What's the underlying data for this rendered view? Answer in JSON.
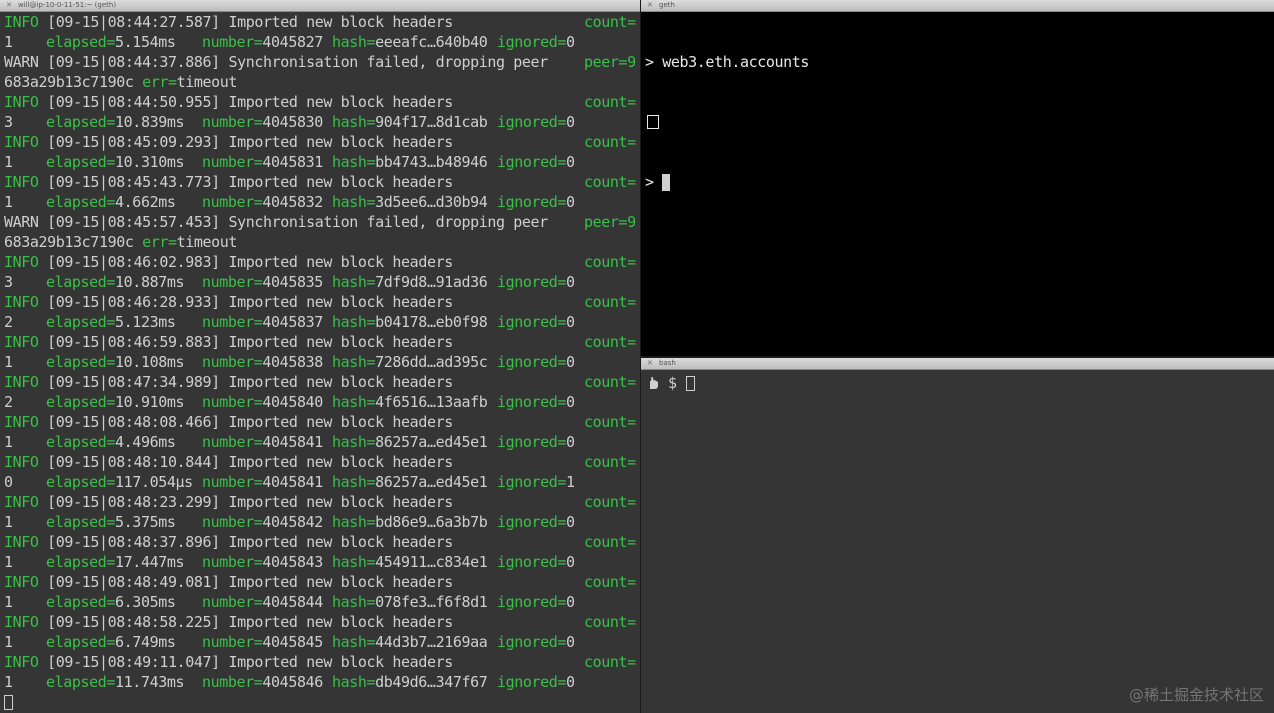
{
  "left_pane": {
    "title": "will@ip-10-0-11-51:~ (geth)",
    "entries": [
      {
        "level": "INFO",
        "ts": "[09-15|08:44:27.587]",
        "msg": "Imported new block headers",
        "rk": "count=",
        "count": "1",
        "elapsed": "5.154ms",
        "number": "4045827",
        "hash": "eeeafc…640b40",
        "ignored": "0"
      },
      {
        "level": "WARN",
        "ts": "[09-15|08:44:37.886]",
        "msg": "Synchronisation failed, dropping peer",
        "rk": "peer=9",
        "cont": "683a29b13c7190c",
        "err": "timeout"
      },
      {
        "level": "INFO",
        "ts": "[09-15|08:44:50.955]",
        "msg": "Imported new block headers",
        "rk": "count=",
        "count": "3",
        "elapsed": "10.839ms",
        "number": "4045830",
        "hash": "904f17…8d1cab",
        "ignored": "0"
      },
      {
        "level": "INFO",
        "ts": "[09-15|08:45:09.293]",
        "msg": "Imported new block headers",
        "rk": "count=",
        "count": "1",
        "elapsed": "10.310ms",
        "number": "4045831",
        "hash": "bb4743…b48946",
        "ignored": "0"
      },
      {
        "level": "INFO",
        "ts": "[09-15|08:45:43.773]",
        "msg": "Imported new block headers",
        "rk": "count=",
        "count": "1",
        "elapsed": "4.662ms",
        "number": "4045832",
        "hash": "3d5ee6…d30b94",
        "ignored": "0"
      },
      {
        "level": "WARN",
        "ts": "[09-15|08:45:57.453]",
        "msg": "Synchronisation failed, dropping peer",
        "rk": "peer=9",
        "cont": "683a29b13c7190c",
        "err": "timeout"
      },
      {
        "level": "INFO",
        "ts": "[09-15|08:46:02.983]",
        "msg": "Imported new block headers",
        "rk": "count=",
        "count": "3",
        "elapsed": "10.887ms",
        "number": "4045835",
        "hash": "7df9d8…91ad36",
        "ignored": "0"
      },
      {
        "level": "INFO",
        "ts": "[09-15|08:46:28.933]",
        "msg": "Imported new block headers",
        "rk": "count=",
        "count": "2",
        "elapsed": "5.123ms",
        "number": "4045837",
        "hash": "b04178…eb0f98",
        "ignored": "0"
      },
      {
        "level": "INFO",
        "ts": "[09-15|08:46:59.883]",
        "msg": "Imported new block headers",
        "rk": "count=",
        "count": "1",
        "elapsed": "10.108ms",
        "number": "4045838",
        "hash": "7286dd…ad395c",
        "ignored": "0"
      },
      {
        "level": "INFO",
        "ts": "[09-15|08:47:34.989]",
        "msg": "Imported new block headers",
        "rk": "count=",
        "count": "2",
        "elapsed": "10.910ms",
        "number": "4045840",
        "hash": "4f6516…13aafb",
        "ignored": "0"
      },
      {
        "level": "INFO",
        "ts": "[09-15|08:48:08.466]",
        "msg": "Imported new block headers",
        "rk": "count=",
        "count": "1",
        "elapsed": "4.496ms",
        "number": "4045841",
        "hash": "86257a…ed45e1",
        "ignored": "0"
      },
      {
        "level": "INFO",
        "ts": "[09-15|08:48:10.844]",
        "msg": "Imported new block headers",
        "rk": "count=",
        "count": "0",
        "elapsed": "117.054µs",
        "number": "4045841",
        "hash": "86257a…ed45e1",
        "ignored": "1"
      },
      {
        "level": "INFO",
        "ts": "[09-15|08:48:23.299]",
        "msg": "Imported new block headers",
        "rk": "count=",
        "count": "1",
        "elapsed": "5.375ms",
        "number": "4045842",
        "hash": "bd86e9…6a3b7b",
        "ignored": "0"
      },
      {
        "level": "INFO",
        "ts": "[09-15|08:48:37.896]",
        "msg": "Imported new block headers",
        "rk": "count=",
        "count": "1",
        "elapsed": "17.447ms",
        "number": "4045843",
        "hash": "454911…c834e1",
        "ignored": "0"
      },
      {
        "level": "INFO",
        "ts": "[09-15|08:48:49.081]",
        "msg": "Imported new block headers",
        "rk": "count=",
        "count": "1",
        "elapsed": "6.305ms",
        "number": "4045844",
        "hash": "078fe3…f6f8d1",
        "ignored": "0"
      },
      {
        "level": "INFO",
        "ts": "[09-15|08:48:58.225]",
        "msg": "Imported new block headers",
        "rk": "count=",
        "count": "1",
        "elapsed": "6.749ms",
        "number": "4045845",
        "hash": "44d3b7…2169aa",
        "ignored": "0"
      },
      {
        "level": "INFO",
        "ts": "[09-15|08:49:11.047]",
        "msg": "Imported new block headers",
        "rk": "count=",
        "count": "1",
        "elapsed": "11.743ms",
        "number": "4045846",
        "hash": "db49d6…347f67",
        "ignored": "0"
      }
    ],
    "keys": {
      "elapsed": "elapsed=",
      "number": "number=",
      "hash": "hash=",
      "ignored": "ignored=",
      "err": "err="
    }
  },
  "geth_pane": {
    "title": "geth",
    "prompt": ">",
    "command": "web3.eth.accounts"
  },
  "bash_pane": {
    "title": "bash",
    "prompt": "$"
  },
  "watermark": "@稀土掘金技术社区",
  "colors": {
    "info": "#3bbf4b",
    "text": "#cfcfcf",
    "term_bg": "#353535",
    "geth_bg": "#000000"
  }
}
